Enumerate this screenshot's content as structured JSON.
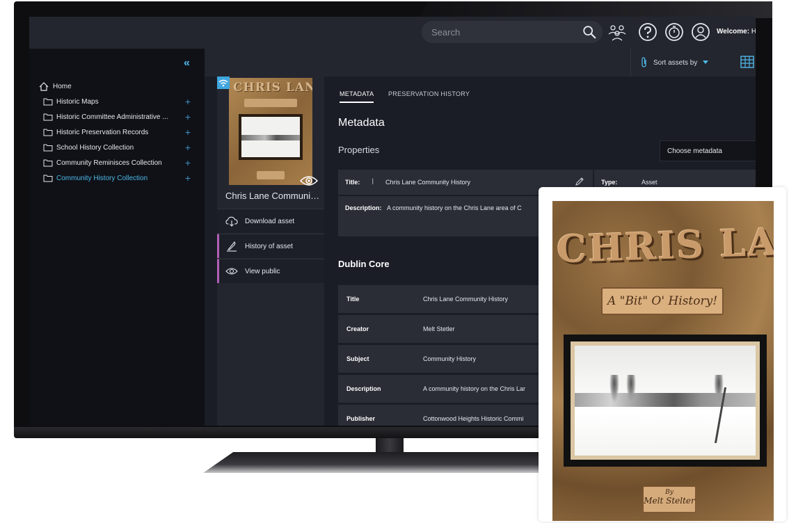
{
  "header": {
    "search_placeholder": "Search",
    "welcome_label": "Welcome: ",
    "welcome_name": "H"
  },
  "sidebar": {
    "collapse_label": "«",
    "home_label": "Home",
    "items": [
      {
        "label": "Historic Maps"
      },
      {
        "label": "Historic Committee Administrative ..."
      },
      {
        "label": "Historic Preservation Records"
      },
      {
        "label": "School History Collection"
      },
      {
        "label": "Community Reminisces Collection"
      },
      {
        "label": "Community History Collection",
        "active": true
      }
    ]
  },
  "toolbar": {
    "sort_label": "Sort assets by"
  },
  "asset": {
    "name": "Chris Lane Community History",
    "thumb_title": "CHRIS LANE",
    "actions": [
      {
        "label": "Download asset"
      },
      {
        "label": "History of asset"
      },
      {
        "label": "View public"
      }
    ]
  },
  "main": {
    "tabs": [
      {
        "label": "METADATA",
        "active": true
      },
      {
        "label": "PRESERVATION HISTORY"
      }
    ],
    "heading": "Metadata",
    "properties_heading": "Properties",
    "choose_metadata": "Choose metadata",
    "properties": {
      "title_label": "Title:",
      "title_value": "Chris Lane Community History",
      "type_label": "Type:",
      "type_value": "Asset",
      "description_label": "Description:",
      "description_value": "A community history on the Chris Lane area of C"
    },
    "dublin_core_heading": "Dublin Core",
    "dublin_core": [
      {
        "label": "Title",
        "value": "Chris Lane Community History"
      },
      {
        "label": "Creator",
        "value": "Melt Stetler"
      },
      {
        "label": "Subject",
        "value": "Community History"
      },
      {
        "label": "Description",
        "value": "A community history on the Chris Lar"
      },
      {
        "label": "Publisher",
        "value": "Cottonwood Heights Historic Commi"
      }
    ]
  },
  "cover": {
    "title": "CHRIS LANE",
    "subtitle": "A \"Bit\" O' History!",
    "by": "By",
    "author": "Melt Stelter"
  },
  "colors": {
    "accent": "#4fb8e8",
    "sidebar_bg": "#0f1117",
    "panel_bg": "#23262f",
    "row_bg": "#2a2d36",
    "action_accent": "#b05fb6"
  }
}
